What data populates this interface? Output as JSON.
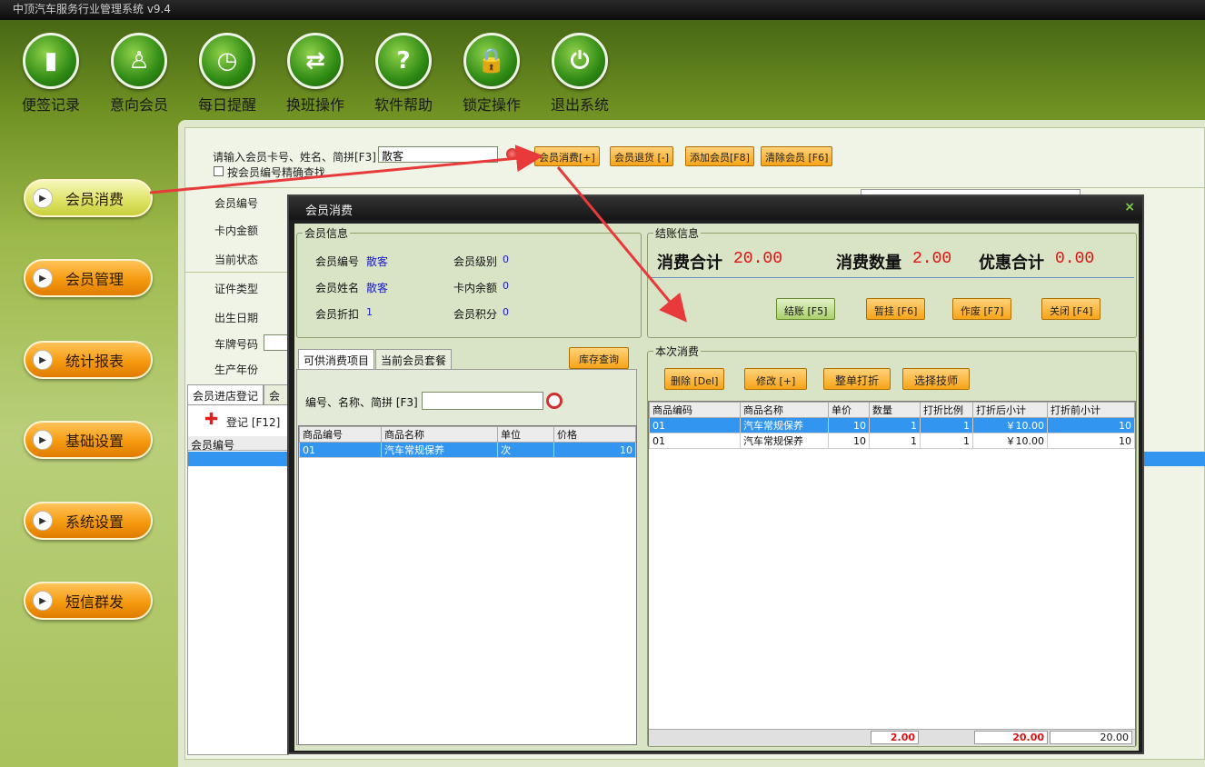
{
  "window": {
    "title": "中顶汽车服务行业管理系统 v9.4"
  },
  "toolbar": [
    {
      "label": "便签记录",
      "icon": "note-icon",
      "glyph": "▮"
    },
    {
      "label": "意向会员",
      "icon": "person-icon",
      "glyph": "♙"
    },
    {
      "label": "每日提醒",
      "icon": "alarm-clock-icon",
      "glyph": "◷"
    },
    {
      "label": "换班操作",
      "icon": "swap-arrows-icon",
      "glyph": "⇄"
    },
    {
      "label": "软件帮助",
      "icon": "help-icon",
      "glyph": "?"
    },
    {
      "label": "锁定操作",
      "icon": "lock-icon",
      "glyph": "🔒"
    },
    {
      "label": "退出系统",
      "icon": "power-icon",
      "glyph": "⏻"
    }
  ],
  "nav": [
    "会员消费",
    "会员管理",
    "统计报表",
    "基础设置",
    "系统设置",
    "短信群发"
  ],
  "search": {
    "label": "请输入会员卡号、姓名、简拼[F3]",
    "value": "散客",
    "checkbox": "按会员编号精确查找"
  },
  "actions": {
    "consume": "会员消费[+]",
    "refund": "会员退货 [-]",
    "add": "添加会员[F8]",
    "clear": "清除会员 [F6]"
  },
  "fields": {
    "member_no": "会员编号",
    "card_balance": "卡内金额",
    "status": "当前状态",
    "id_type": "证件类型",
    "birthday": "出生日期",
    "plate": "车牌号码",
    "year": "生产年份"
  },
  "lower_tabs": {
    "t1": "会员进店登记",
    "t2": "会员"
  },
  "register": {
    "btn": "登记 [F12]",
    "col": "会员编号"
  },
  "dialog": {
    "title": "会员消费",
    "close": "×",
    "member_info": {
      "title": "会员信息",
      "no_label": "会员编号",
      "no": "散客",
      "level_label": "会员级别",
      "level": "0",
      "name_label": "会员姓名",
      "name": "散客",
      "balance_label": "卡内余额",
      "balance": "0",
      "discount_label": "会员折扣",
      "discount": "1",
      "points_label": "会员积分",
      "points": "0"
    },
    "checkout": {
      "title": "结账信息",
      "total_label": "消费合计",
      "total": "20.00",
      "qty_label": "消费数量",
      "qty": "2.00",
      "disc_label": "优惠合计",
      "disc": "0.00",
      "pay": "结账 [F5]",
      "hold": "暂挂 [F6]",
      "void": "作废 [F7]",
      "close": "关闭 [F4]"
    },
    "tabs": {
      "t1": "可供消费项目",
      "t2": "当前会员套餐"
    },
    "stock_btn": "库存查询",
    "item_search_label": "编号、名称、简拼 [F3]",
    "items": {
      "cols": [
        "商品编号",
        "商品名称",
        "单位",
        "价格"
      ],
      "rows": [
        [
          "01",
          "汽车常规保养",
          "次",
          "10"
        ]
      ]
    },
    "current": {
      "title": "本次消费",
      "del": "删除 [Del]",
      "edit": "修改 [+]",
      "print": "整单打折",
      "tech": "选择技师",
      "cols": [
        "商品编码",
        "商品名称",
        "单价",
        "数量",
        "打折比例",
        "打折后小计",
        "打折前小计"
      ],
      "rows": [
        [
          "01",
          "汽车常规保养",
          "10",
          "1",
          "1",
          "￥10.00",
          "10"
        ],
        [
          "01",
          "汽车常规保养",
          "10",
          "1",
          "1",
          "￥10.00",
          "10"
        ]
      ],
      "sum_qty": "2.00",
      "sum_after": "20.00",
      "sum_before": "20.00"
    }
  },
  "colors": {
    "accent": "#f59a10",
    "selected": "#3296f0",
    "red": "#e01010",
    "arrow": "#e83a3a"
  }
}
